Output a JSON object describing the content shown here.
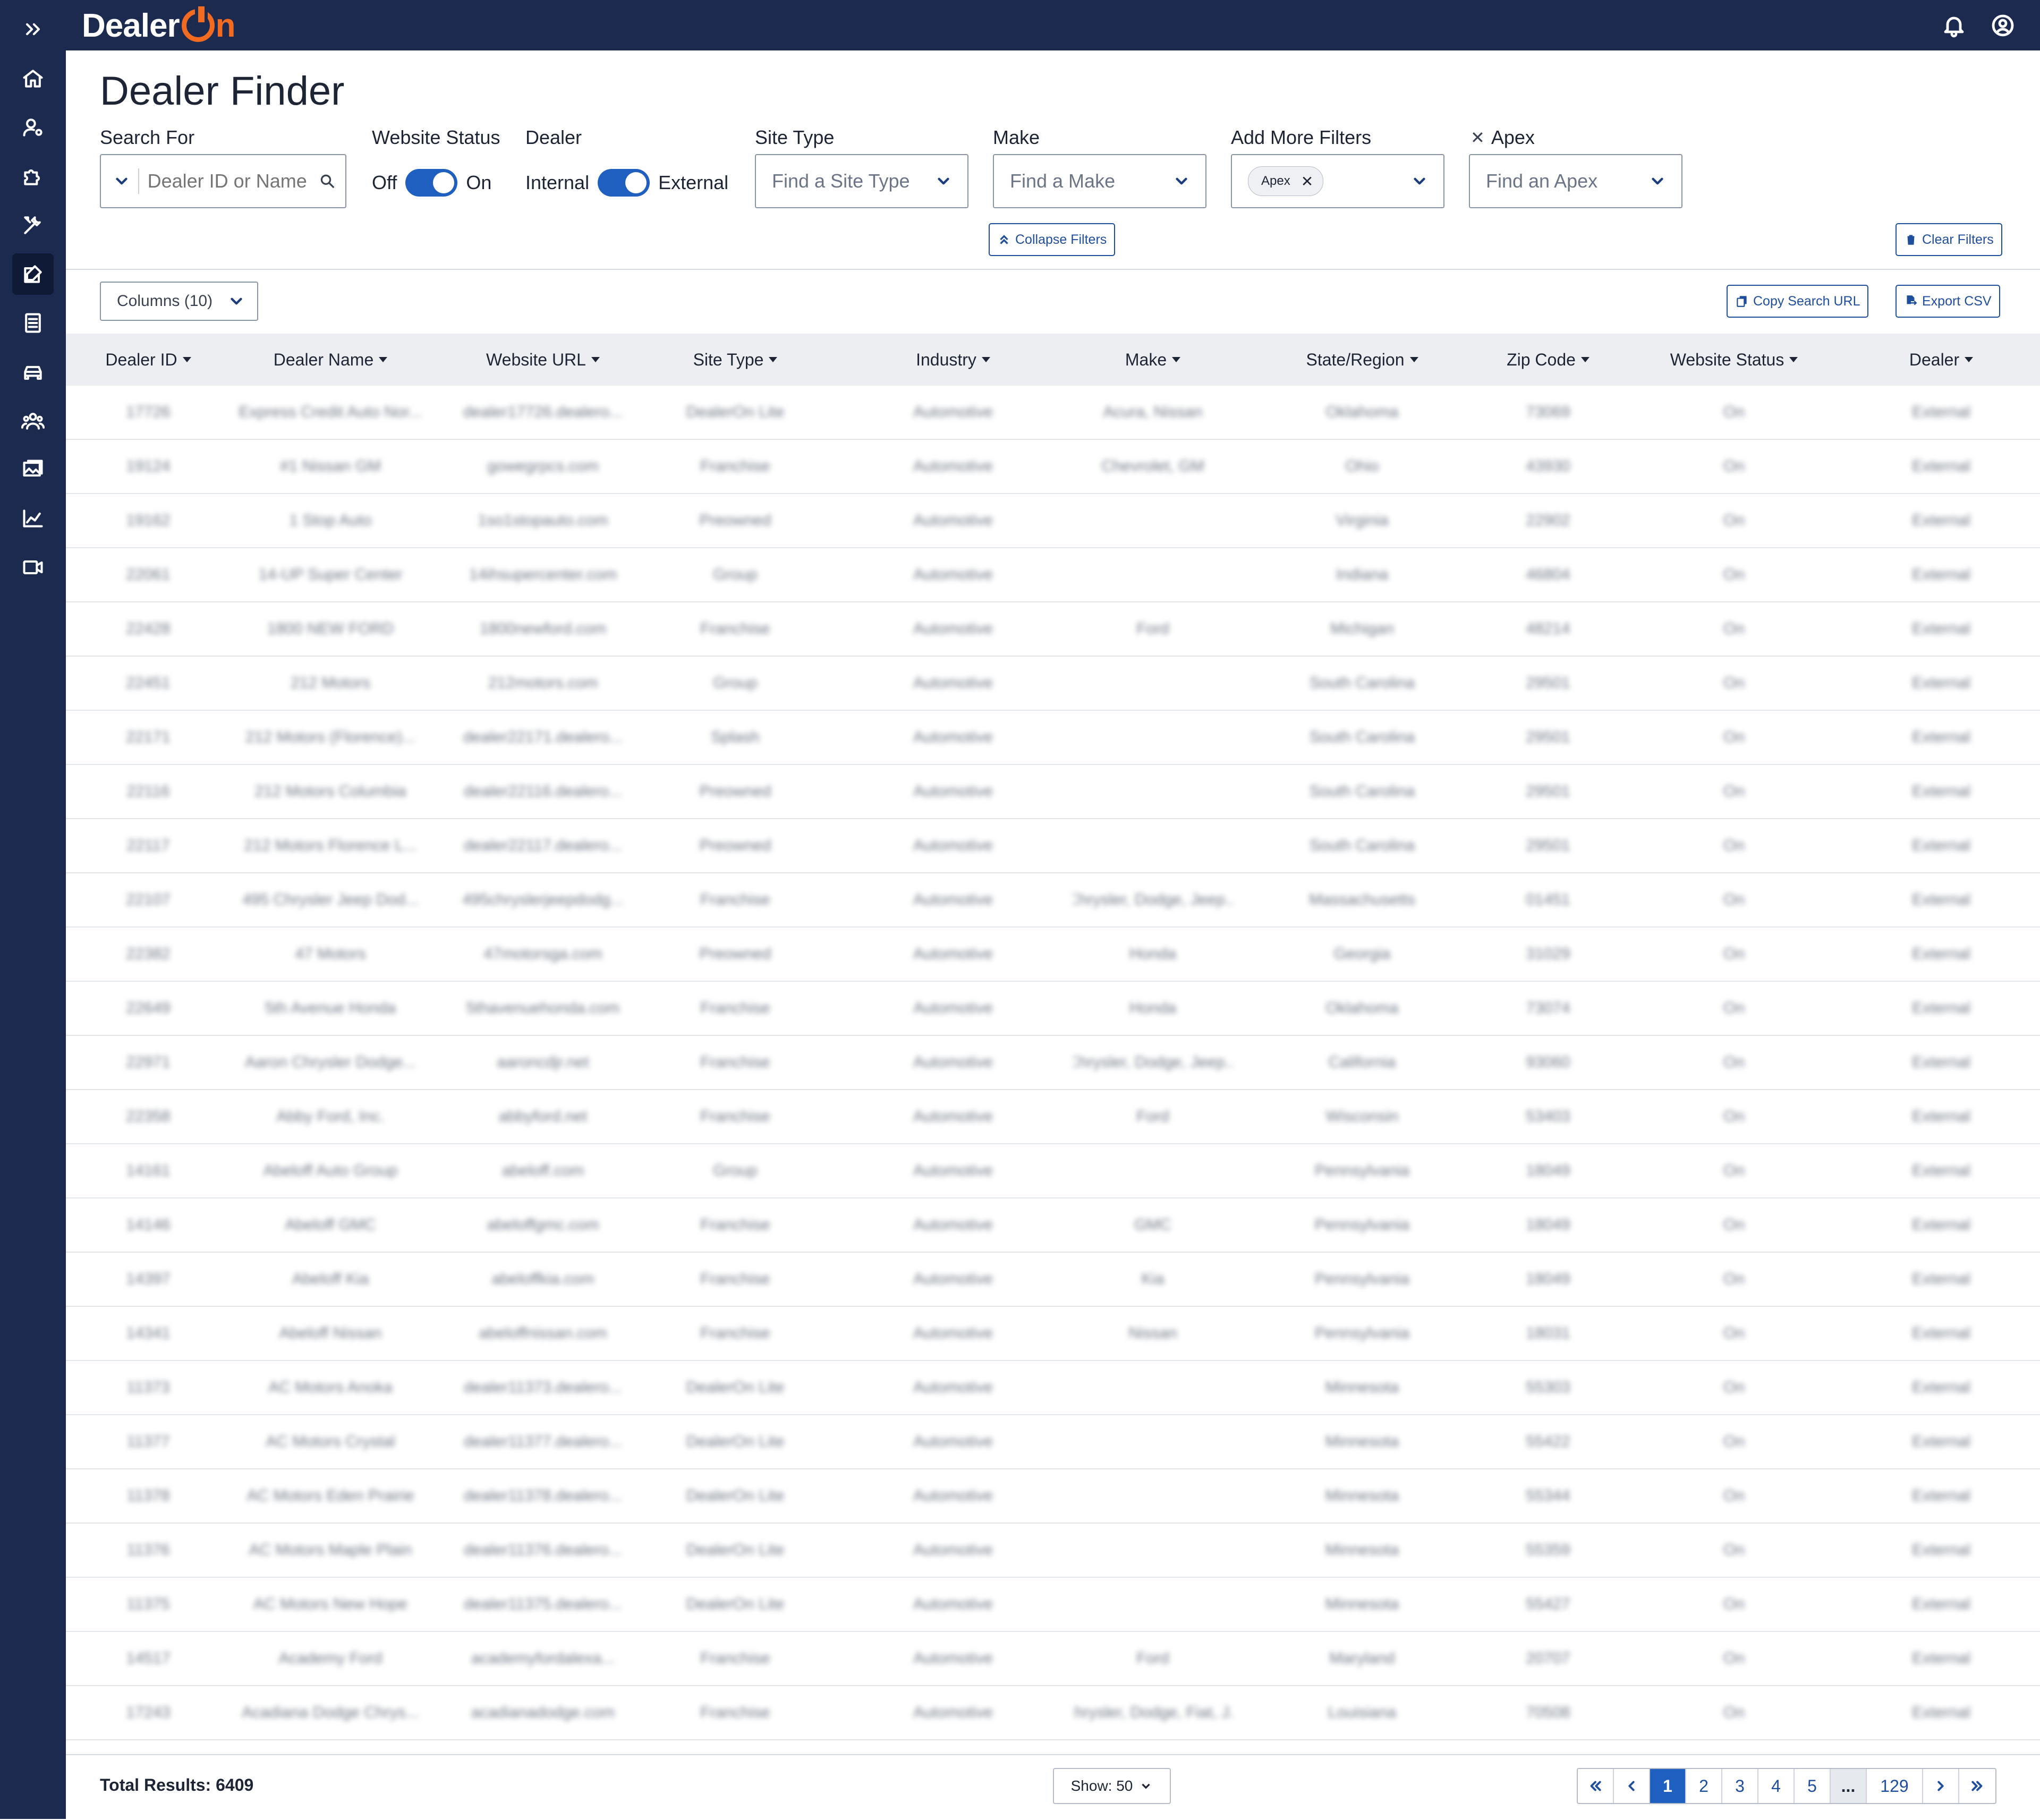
{
  "app": {
    "logo_text": "Dealer",
    "logo_n": "n"
  },
  "page": {
    "title": "Dealer Finder"
  },
  "filters": {
    "search_label": "Search For",
    "search_placeholder": "Dealer ID or Name",
    "website_status_label": "Website Status",
    "website_status_off": "Off",
    "website_status_on": "On",
    "website_status_enabled": true,
    "dealer_label": "Dealer",
    "dealer_internal": "Internal",
    "dealer_external": "External",
    "dealer_external_enabled": true,
    "site_type_label": "Site Type",
    "site_type_placeholder": "Find a Site Type",
    "make_label": "Make",
    "make_placeholder": "Find a Make",
    "add_more_label": "Add More Filters",
    "add_more_chip": "Apex",
    "apex_label": "Apex",
    "apex_placeholder": "Find an Apex",
    "collapse_filters": "Collapse Filters",
    "clear_filters": "Clear Filters"
  },
  "toolbar": {
    "columns_button": "Columns (10)",
    "copy_search_url": "Copy Search URL",
    "export_csv": "Export CSV"
  },
  "table": {
    "columns": [
      "Dealer ID",
      "Dealer Name",
      "Website URL",
      "Site Type",
      "Industry",
      "Make",
      "State/Region",
      "Zip Code",
      "Website Status",
      "Dealer"
    ],
    "rows": [
      [
        "17726",
        "Express Credit Auto Nor...",
        "dealer17726.dealero...",
        "DealerOn Lite",
        "Automotive",
        "Acura, Nissan",
        "Oklahoma",
        "73069",
        "On",
        "External"
      ],
      [
        "19124",
        "#1 Nissan GM",
        "gowegrpcs.com",
        "Franchise",
        "Automotive",
        "Chevrolet, GM",
        "Ohio",
        "43930",
        "On",
        "External"
      ],
      [
        "19162",
        "1 Stop Auto",
        "1so1stopauto.com",
        "Preowned",
        "Automotive",
        "",
        "Virginia",
        "22902",
        "On",
        "External"
      ],
      [
        "22061",
        "14-UP Super Center",
        "14ihsupercenter.com",
        "Group",
        "Automotive",
        "",
        "Indiana",
        "46804",
        "On",
        "External"
      ],
      [
        "22428",
        "1800 NEW FORD",
        "1800newford.com",
        "Franchise",
        "Automotive",
        "Ford",
        "Michigan",
        "48214",
        "On",
        "External"
      ],
      [
        "22451",
        "212 Motors",
        "212motors.com",
        "Group",
        "Automotive",
        "",
        "South Carolina",
        "29501",
        "On",
        "External"
      ],
      [
        "22171",
        "212 Motors (Florence)...",
        "dealer22171.dealero...",
        "Splash",
        "Automotive",
        "",
        "South Carolina",
        "29501",
        "On",
        "External"
      ],
      [
        "22116",
        "212 Motors Columbia",
        "dealer22116.dealero...",
        "Preowned",
        "Automotive",
        "",
        "South Carolina",
        "29501",
        "On",
        "External"
      ],
      [
        "22117",
        "212 Motors Florence L...",
        "dealer22117.dealero...",
        "Preowned",
        "Automotive",
        "",
        "South Carolina",
        "29501",
        "On",
        "External"
      ],
      [
        "22107",
        "495 Chrysler Jeep Dod...",
        "495chryslerjeepdodg...",
        "Franchise",
        "Automotive",
        "Chrysler, Dodge, Jeep...",
        "Massachusetts",
        "01451",
        "On",
        "External"
      ],
      [
        "22382",
        "47 Motors",
        "47motorsga.com",
        "Preowned",
        "Automotive",
        "Honda",
        "Georgia",
        "31029",
        "On",
        "External"
      ],
      [
        "22649",
        "5th Avenue Honda",
        "5thavenuehonda.com",
        "Franchise",
        "Automotive",
        "Honda",
        "Oklahoma",
        "73074",
        "On",
        "External"
      ],
      [
        "22971",
        "Aaron Chrysler Dodge...",
        "aaroncdjr.net",
        "Franchise",
        "Automotive",
        "Chrysler, Dodge, Jeep...",
        "California",
        "93060",
        "On",
        "External"
      ],
      [
        "22358",
        "Abby Ford, Inc.",
        "abbyford.net",
        "Franchise",
        "Automotive",
        "Ford",
        "Wisconsin",
        "53403",
        "On",
        "External"
      ],
      [
        "14161",
        "Abeloff Auto Group",
        "abeloff.com",
        "Group",
        "Automotive",
        "",
        "Pennsylvania",
        "18049",
        "On",
        "External"
      ],
      [
        "14146",
        "Abeloff GMC",
        "abeloffgmc.com",
        "Franchise",
        "Automotive",
        "GMC",
        "Pennsylvania",
        "18049",
        "On",
        "External"
      ],
      [
        "14397",
        "Abeloff Kia",
        "abeloffkia.com",
        "Franchise",
        "Automotive",
        "Kia",
        "Pennsylvania",
        "18049",
        "On",
        "External"
      ],
      [
        "14341",
        "Abeloff Nissan",
        "abeloffnissan.com",
        "Franchise",
        "Automotive",
        "Nissan",
        "Pennsylvania",
        "18031",
        "On",
        "External"
      ],
      [
        "11373",
        "AC Motors Anoka",
        "dealer11373.dealero...",
        "DealerOn Lite",
        "Automotive",
        "",
        "Minnesota",
        "55303",
        "On",
        "External"
      ],
      [
        "11377",
        "AC Motors Crystal",
        "dealer11377.dealero...",
        "DealerOn Lite",
        "Automotive",
        "",
        "Minnesota",
        "55422",
        "On",
        "External"
      ],
      [
        "11378",
        "AC Motors Eden Prairie",
        "dealer11378.dealero...",
        "DealerOn Lite",
        "Automotive",
        "",
        "Minnesota",
        "55344",
        "On",
        "External"
      ],
      [
        "11376",
        "AC Motors Maple Plain",
        "dealer11376.dealero...",
        "DealerOn Lite",
        "Automotive",
        "",
        "Minnesota",
        "55359",
        "On",
        "External"
      ],
      [
        "11375",
        "AC Motors New Hope",
        "dealer11375.dealero...",
        "DealerOn Lite",
        "Automotive",
        "",
        "Minnesota",
        "55427",
        "On",
        "External"
      ],
      [
        "14517",
        "Academy Ford",
        "academyfordalexa...",
        "Franchise",
        "Automotive",
        "Ford",
        "Maryland",
        "20707",
        "On",
        "External"
      ],
      [
        "17243",
        "Acadiana Dodge Chrys...",
        "acadianadodge.com",
        "Franchise",
        "Automotive",
        "Chrysler, Dodge, Fiat, J...",
        "Louisiana",
        "70508",
        "On",
        "External"
      ]
    ]
  },
  "footer": {
    "total_results": "Total Results: 6409",
    "show": "Show: 50",
    "pages": [
      "1",
      "2",
      "3",
      "4",
      "5",
      "...",
      "129"
    ],
    "current_page": "1"
  },
  "colors": {
    "nav_bg": "#1c2a4f",
    "accent_orange": "#f26b21",
    "primary_blue": "#1f5fbf",
    "header_row_bg": "#eceef2"
  },
  "icons": {
    "sidebar": [
      "expand-icon",
      "home-icon",
      "user-settings-icon",
      "puzzle-icon",
      "tools-icon",
      "edit-icon",
      "clipboard-icon",
      "car-icon",
      "users-icon",
      "image-gallery-icon",
      "chart-line-icon",
      "video-icon"
    ],
    "topbar": [
      "bell-icon",
      "user-circle-icon"
    ]
  }
}
